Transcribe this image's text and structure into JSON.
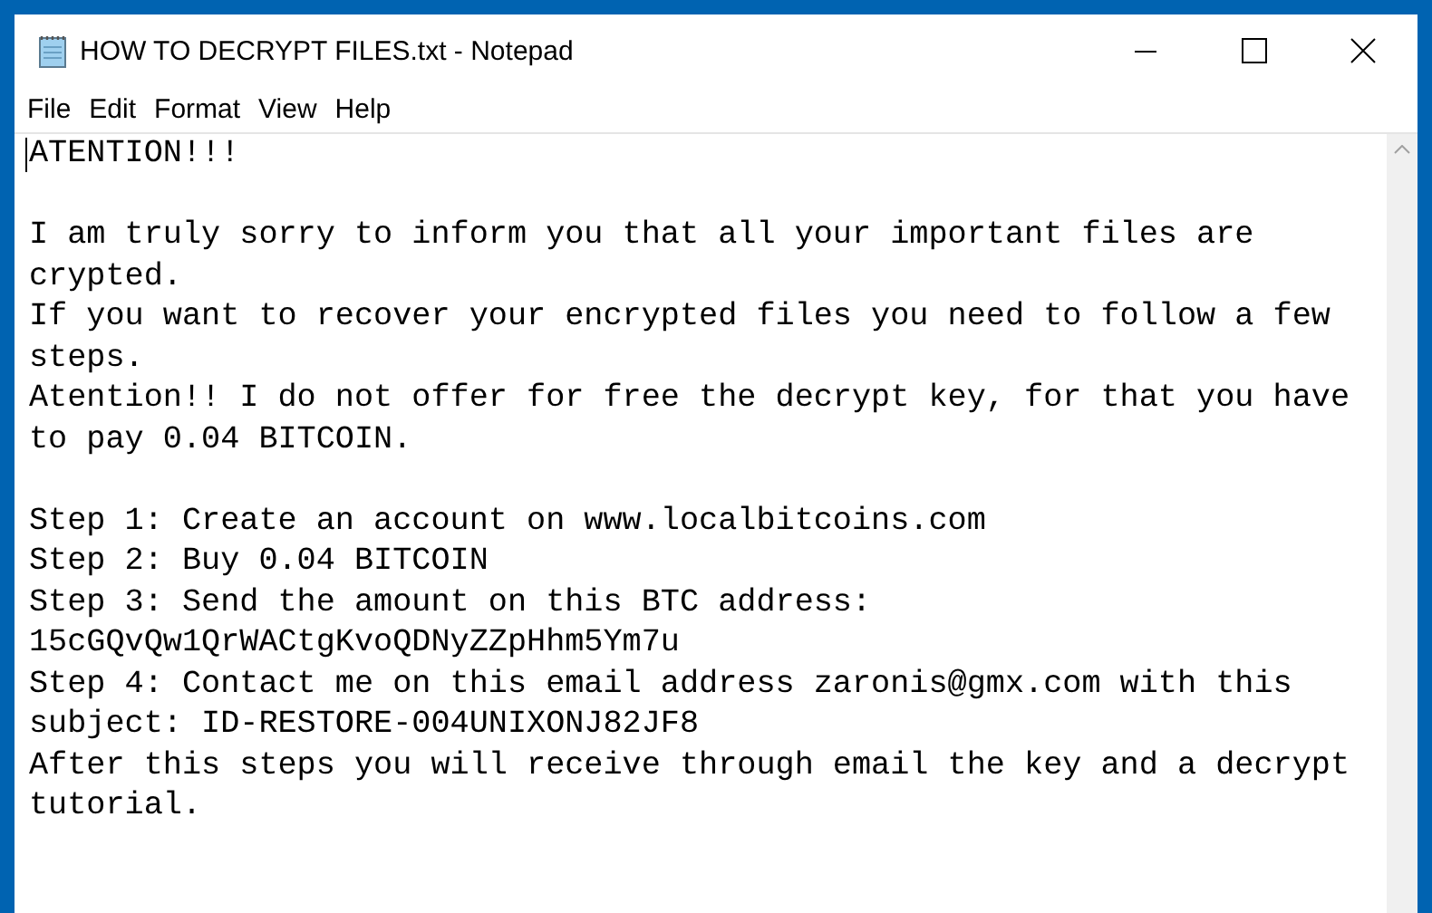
{
  "window": {
    "title": "HOW TO DECRYPT FILES.txt - Notepad"
  },
  "menu": [
    "File",
    "Edit",
    "Format",
    "View",
    "Help"
  ],
  "document": {
    "blocks": [
      [
        "ATENTION!!!"
      ],
      [
        "I am truly sorry to inform you that all your important files are",
        "crypted.",
        "If you want to recover your encrypted files you need to follow a few",
        "steps.",
        "Atention!! I do not offer for free the decrypt key, for that you have",
        "to pay 0.04 BITCOIN."
      ],
      [
        "Step 1: Create an account on www.localbitcoins.com",
        "Step 2: Buy 0.04 BITCOIN",
        "Step 3: Send the amount on this BTC address:",
        "15cGQvQw1QrWACtgKvoQDNyZZpHhm5Ym7u",
        "Step 4: Contact me on this email address zaronis@gmx.com with this",
        "subject: ID-RESTORE-004UNIXONJ82JF8",
        "After this steps you will receive through email the key and a decrypt",
        "tutorial."
      ]
    ]
  }
}
